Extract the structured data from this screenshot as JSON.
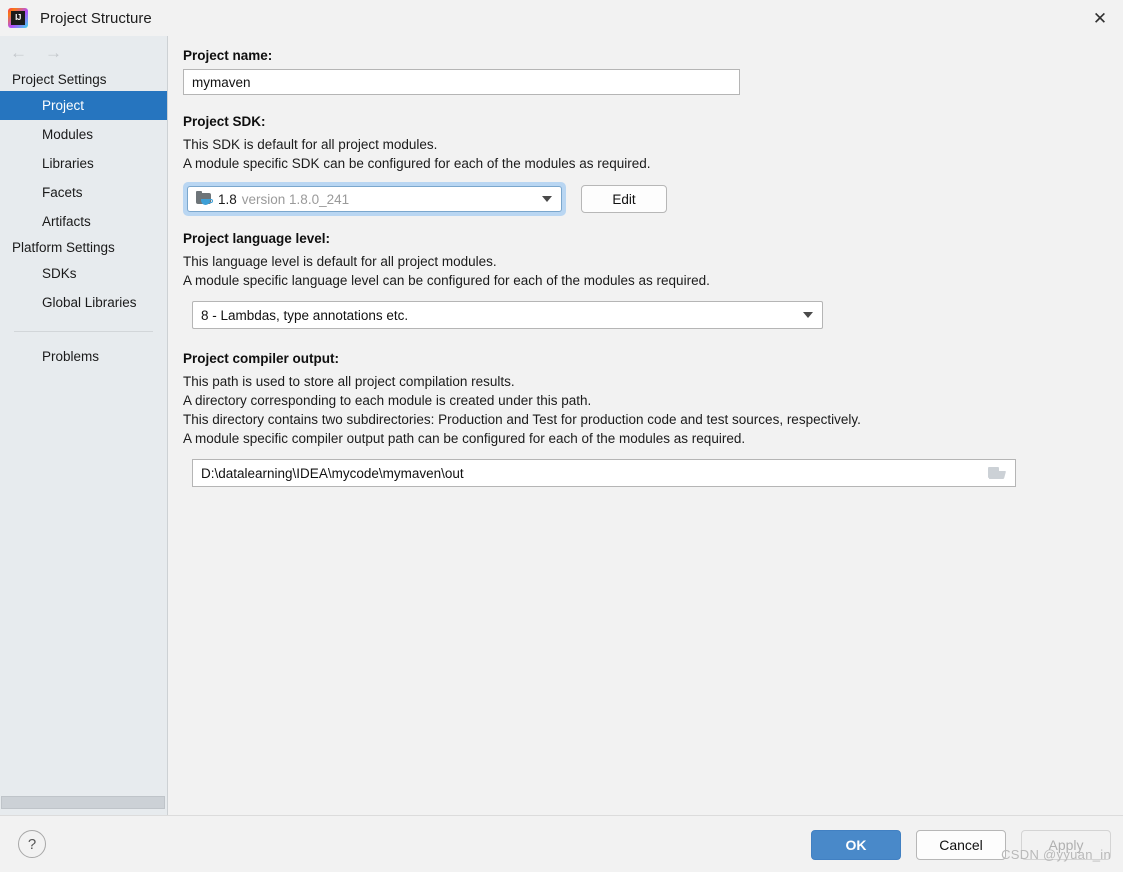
{
  "window": {
    "title": "Project Structure",
    "app_icon": "intellij-idea-icon",
    "close_icon": "✕"
  },
  "sidebar": {
    "back_icon": "←",
    "forward_icon": "→",
    "groups": [
      {
        "title": "Project Settings",
        "items": [
          {
            "label": "Project",
            "selected": true
          },
          {
            "label": "Modules",
            "selected": false
          },
          {
            "label": "Libraries",
            "selected": false
          },
          {
            "label": "Facets",
            "selected": false
          },
          {
            "label": "Artifacts",
            "selected": false
          }
        ]
      },
      {
        "title": "Platform Settings",
        "items": [
          {
            "label": "SDKs",
            "selected": false
          },
          {
            "label": "Global Libraries",
            "selected": false
          }
        ]
      }
    ],
    "problems_label": "Problems"
  },
  "main": {
    "project_name": {
      "label": "Project name:",
      "value": "mymaven"
    },
    "project_sdk": {
      "label": "Project SDK:",
      "desc_line_1": "This SDK is default for all project modules.",
      "desc_line_2": "A module specific SDK can be configured for each of the modules as required.",
      "sdk_icon": "java-sdk-folder-icon",
      "sdk_name": "1.8",
      "sdk_version": "version 1.8.0_241",
      "dropdown_icon": "chevron-down-icon",
      "edit_label": "Edit"
    },
    "language_level": {
      "label": "Project language level:",
      "desc_line_1": "This language level is default for all project modules.",
      "desc_line_2": "A module specific language level can be configured for each of the modules as required.",
      "value": "8 - Lambdas, type annotations etc.",
      "dropdown_icon": "chevron-down-icon"
    },
    "compiler_output": {
      "label": "Project compiler output:",
      "desc_line_1": "This path is used to store all project compilation results.",
      "desc_line_2": "A directory corresponding to each module is created under this path.",
      "desc_line_3": "This directory contains two subdirectories: Production and Test for production code and test sources, respectively.",
      "desc_line_4": "A module specific compiler output path can be configured for each of the modules as required.",
      "value": "D:\\datalearning\\IDEA\\mycode\\mymaven\\out",
      "browse_icon": "folder-open-icon"
    }
  },
  "footer": {
    "help_icon": "?",
    "ok_label": "OK",
    "cancel_label": "Cancel",
    "apply_label": "Apply"
  },
  "watermark": {
    "text": "CSDN @yyuan_in"
  },
  "colors": {
    "selection_blue": "#2675bf",
    "ok_blue": "#4989c9",
    "sidebar_bg": "#e7ebee",
    "content_bg": "#f2f2f2",
    "focus_ring": "#b9d6f2"
  }
}
